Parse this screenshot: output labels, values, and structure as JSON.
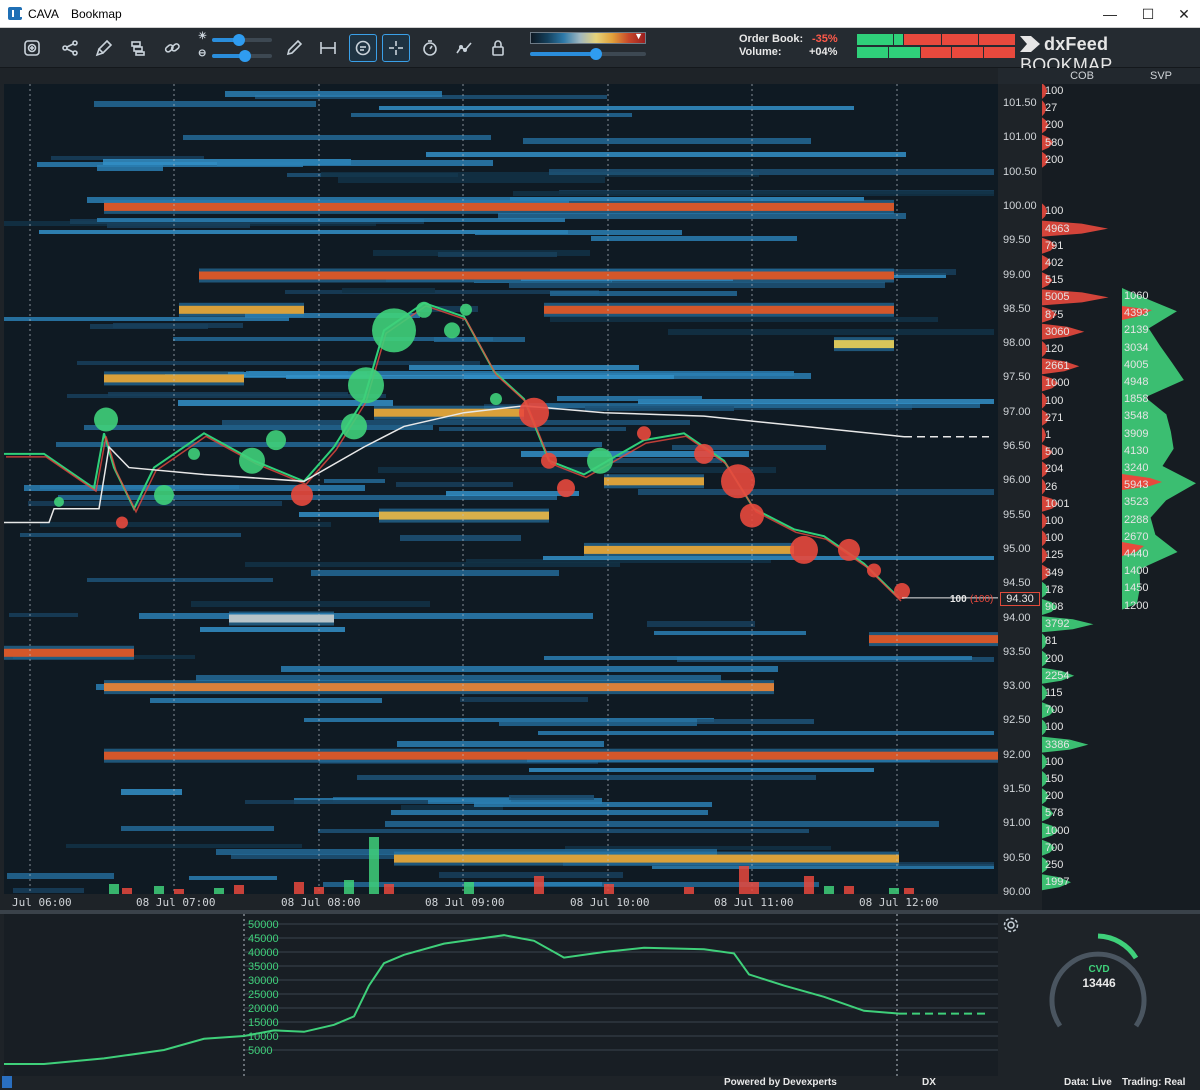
{
  "window": {
    "app_name": "CAVA",
    "title": "Bookmap"
  },
  "window_controls": {
    "minimize": "—",
    "maximize": "☐",
    "close": "✕"
  },
  "toolbar": {
    "tools": [
      "zoom-fit-icon",
      "share-icon",
      "brush-icon",
      "layers-icon",
      "link-icon",
      "pencil-icon",
      "measure-icon",
      "chat-icon",
      "crosshair-icon",
      "stopwatch-icon",
      "indicator-icon",
      "lock-icon"
    ],
    "active_tools": [
      "chat-icon",
      "crosshair-icon"
    ],
    "sliders": {
      "brightness": 0.45,
      "contrast": 0.55,
      "heatmap_threshold": 0.57
    }
  },
  "stats": {
    "order_book_label": "Order Book:",
    "order_book_value": "-35%",
    "volume_label": "Volume:",
    "volume_value": "+04%",
    "colors": {
      "negative": "#ff5a4a",
      "positive": "#e8e8e8"
    }
  },
  "logo": {
    "text_bold": "dxFeed",
    "text": "BOOKMAP"
  },
  "columns": {
    "cob": "COB",
    "svp": "SVP"
  },
  "price_axis": {
    "labels": [
      "101.50",
      "101.00",
      "100.50",
      "100.00",
      "99.50",
      "99.00",
      "98.50",
      "98.00",
      "97.50",
      "97.00",
      "96.50",
      "96.00",
      "95.50",
      "95.00",
      "94.50",
      "94.00",
      "93.50",
      "93.00",
      "92.50",
      "92.00",
      "91.50",
      "91.00",
      "90.50",
      "90.00"
    ],
    "last_price": "94.30",
    "last_trade_label": "100",
    "last_trade_sub": "(100)"
  },
  "cob_values": [
    "100",
    "27",
    "200",
    "580",
    "200",
    "",
    "",
    "100",
    "4963",
    "791",
    "402",
    "515",
    "5005",
    "875",
    "3060",
    "120",
    "2661",
    "1000",
    "100",
    "271",
    "1",
    "500",
    "204",
    "26",
    "1001",
    "100",
    "100",
    "125",
    "349",
    "178",
    "908",
    "3792",
    "81",
    "200",
    "2254",
    "115",
    "700",
    "100",
    "3386",
    "100",
    "150",
    "200",
    "578",
    "1000",
    "700",
    "250",
    "1997"
  ],
  "svp_values": [
    "1060",
    "4393",
    "2139",
    "3034",
    "4005",
    "4948",
    "1858",
    "3548",
    "3909",
    "4130",
    "3240",
    "5943",
    "3523",
    "2288",
    "2670",
    "4440",
    "1400",
    "1450",
    "1200"
  ],
  "time_axis": {
    "labels": [
      "Jul 06:00",
      "08 Jul 07:00",
      "08 Jul 08:00",
      "08 Jul 09:00",
      "08 Jul 10:00",
      "08 Jul 11:00",
      "08 Jul 12:00"
    ]
  },
  "volume_scale": "18000",
  "cvd": {
    "y_labels": [
      "50000",
      "45000",
      "40000",
      "35000",
      "30000",
      "25000",
      "20000",
      "15000",
      "10000",
      "5000"
    ],
    "widget_label": "CVD",
    "widget_value": "13446",
    "color": "#3fd07a"
  },
  "status": {
    "powered": "Powered by Devexperts",
    "exchange": "DX",
    "data": "Data: Live",
    "trading": "Trading: Real"
  }
}
